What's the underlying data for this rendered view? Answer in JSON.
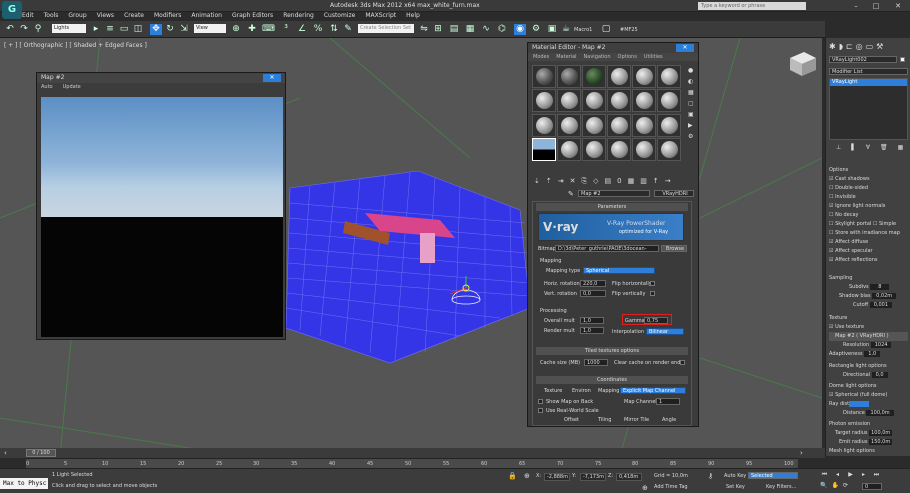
{
  "app": {
    "title": "Autodesk 3ds Max 2012 x64      max_white_furn.max",
    "search_placeholder": "Type a keyword or phrase"
  },
  "menu": [
    "Edit",
    "Tools",
    "Group",
    "Views",
    "Create",
    "Modifiers",
    "Animation",
    "Graph Editors",
    "Rendering",
    "Customize",
    "MAXScript",
    "Help"
  ],
  "toolbar": {
    "selection_filter": "Lights",
    "ref_coord": "View",
    "named_selection": "Create Selection Set",
    "macro1": "Macro1",
    "macro2": "#MF25"
  },
  "viewport": {
    "label": "[ + ] [ Orthographic ] [ Shaded + Edged Faces ]"
  },
  "map_window": {
    "title": "Map #2",
    "tab_auto": "Auto",
    "tab_update": "Update"
  },
  "material_editor": {
    "title": "Material Editor - Map #2",
    "menu": [
      "Modes",
      "Material",
      "Navigation",
      "Options",
      "Utilities"
    ],
    "map_name": "Map #2",
    "map_type": "VRayHDRI",
    "parameters_header": "Parameters",
    "vray_brand": "V·ray",
    "vray_line1": "V-Ray PowerShader",
    "vray_line2": "optimized for V-Ray",
    "bitmap_label": "Bitmap:",
    "bitmap_path": "D:\\3d\\Peter_guthrie\\PAOE\\3docean-1496",
    "browse_label": "Browse",
    "mapping_section": "Mapping",
    "mapping_type_label": "Mapping type",
    "mapping_type": "Spherical",
    "horiz_rotation_label": "Horiz. rotation",
    "horiz_rotation": "220,0",
    "flip_h_label": "Flip horizontally",
    "vert_rotation_label": "Vert. rotation",
    "vert_rotation": "0,0",
    "flip_v_label": "Flip vertically",
    "processing_section": "Processing",
    "overall_mult_label": "Overall mult",
    "overall_mult": "1,0",
    "render_mult_label": "Render mult",
    "render_mult": "1,0",
    "gamma_label": "Gamma",
    "gamma": "0,75",
    "interpolation_label": "Interpolation",
    "interpolation": "Bilinear",
    "tiled_header": "Tiled textures options",
    "cache_label": "Cache size (MB)",
    "cache_value": "1000",
    "clear_cache_label": "Clear cache on render end",
    "coordinates_header": "Coordinates",
    "texture_label": "Texture",
    "environ_label": "Environ",
    "mapping_label": "Mapping",
    "mapping_value": "Explicit Map Channel",
    "show_map_label": "Show Map on Back",
    "map_channel_label": "Map Channel",
    "map_channel": "1",
    "real_world_label": "Use Real-World Scale",
    "col_offset": "Offset",
    "col_tiling": "Tiling",
    "col_mirror": "Mirror Tile",
    "col_angle": "Angle"
  },
  "command_panel": {
    "object_name": "VRayLight002",
    "modifier_list": "Modifier List",
    "stack_item": "VRayLight",
    "options_header": "Options",
    "options": [
      {
        "label": "Cast shadows",
        "on": true
      },
      {
        "label": "Double-sided",
        "on": false
      },
      {
        "label": "Invisible",
        "on": false
      },
      {
        "label": "Ignore light normals",
        "on": true
      },
      {
        "label": "No decay",
        "on": false
      },
      {
        "label": "Skylight portal",
        "on": false
      },
      {
        "label": "Store with irradiance map",
        "on": false
      },
      {
        "label": "Affect diffuse",
        "on": true
      },
      {
        "label": "Affect specular",
        "on": true
      },
      {
        "label": "Affect reflections",
        "on": true
      }
    ],
    "simple_label": "Simple",
    "sampling_header": "Sampling",
    "subdivs_label": "Subdivs",
    "subdivs": "8",
    "shadow_bias_label": "Shadow bias",
    "shadow_bias": "0,02m",
    "cutoff_label": "Cutoff",
    "cutoff": "0,001",
    "texture_header": "Texture",
    "use_texture_label": "Use texture",
    "texture_map": "Map #2  ( VRayHDRI )",
    "resolution_label": "Resolution",
    "resolution": "1024",
    "adaptiveness_label": "Adaptiveness",
    "adaptiveness": "1,0",
    "rect_header": "Rectangle light options",
    "directional_label": "Directional",
    "directional": "0,0",
    "dome_header": "Dome light options",
    "spherical_label": "Spherical (full dome)",
    "ray_dist_label": "Ray dist",
    "distance_label": "Distance",
    "distance": "100,0m",
    "photon_header": "Photon emission",
    "target_radius_label": "Target radius",
    "target_radius": "100,0m",
    "emit_radius_label": "Emit radius",
    "emit_radius": "150,0m",
    "mesh_header": "Mesh light options"
  },
  "timeline": {
    "frame_counter": "0 / 100",
    "ticks": [
      "0",
      "5",
      "10",
      "15",
      "20",
      "25",
      "30",
      "35",
      "40",
      "45",
      "50",
      "55",
      "60",
      "65",
      "70",
      "75",
      "80",
      "85",
      "90",
      "95",
      "100"
    ]
  },
  "status": {
    "maxscript_mini": "Max to Physc",
    "selection_info": "1 Light Selected",
    "prompt": "Click and drag to select and move objects",
    "x_label": "X:",
    "x": "-2,888m",
    "y_label": "Y:",
    "y": "-7,173m",
    "z_label": "Z:",
    "z": "0,418m",
    "grid": "Grid = 10,0m",
    "add_time_tag": "Add Time Tag",
    "auto_key": "Auto Key",
    "auto_key_mode": "Selected",
    "set_key": "Set Key",
    "key_filters": "Key Filters...",
    "frame": "0"
  },
  "colors": {
    "accent": "#2e7fdb",
    "grid_plane": "#3535e8",
    "bench_top": "#d9458a",
    "bench_side": "#a0522d",
    "gamma_highlight": "#e02020"
  }
}
